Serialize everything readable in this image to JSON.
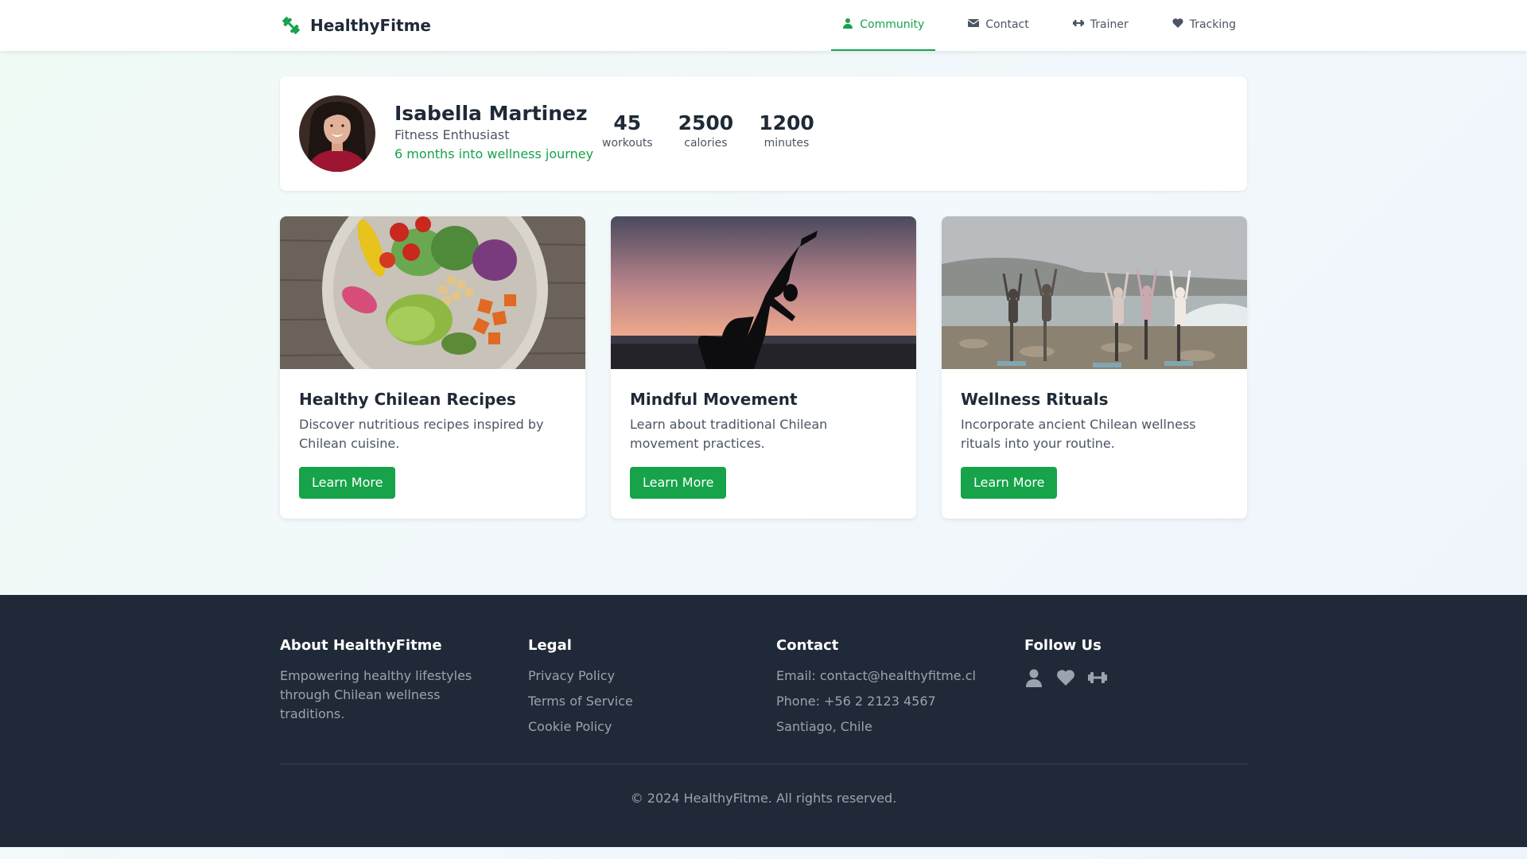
{
  "brand": {
    "name": "HealthyFitme",
    "icon": "dumbbell-icon",
    "accent": "#16a34a"
  },
  "nav": {
    "items": [
      {
        "label": "Community",
        "icon": "user-icon",
        "active": true
      },
      {
        "label": "Contact",
        "icon": "envelope-icon",
        "active": false
      },
      {
        "label": "Trainer",
        "icon": "dumbbell-icon",
        "active": false
      },
      {
        "label": "Tracking",
        "icon": "heart-icon",
        "active": false
      }
    ]
  },
  "profile": {
    "name": "Isabella Martinez",
    "role": "Fitness Enthusiast",
    "journey": "6 months into wellness journey",
    "stats": [
      {
        "value": "45",
        "label": "workouts"
      },
      {
        "value": "2500",
        "label": "calories"
      },
      {
        "value": "1200",
        "label": "minutes"
      }
    ]
  },
  "cards": [
    {
      "title": "Healthy Chilean Recipes",
      "desc": "Discover nutritious recipes inspired by Chilean cuisine.",
      "button": "Learn More"
    },
    {
      "title": "Mindful Movement",
      "desc": "Learn about traditional Chilean movement practices.",
      "button": "Learn More"
    },
    {
      "title": "Wellness Rituals",
      "desc": "Incorporate ancient Chilean wellness rituals into your routine.",
      "button": "Learn More"
    }
  ],
  "footer": {
    "about": {
      "title": "About HealthyFitme",
      "text": "Empowering healthy lifestyles through Chilean wellness traditions."
    },
    "legal": {
      "title": "Legal",
      "links": [
        "Privacy Policy",
        "Terms of Service",
        "Cookie Policy"
      ]
    },
    "contact": {
      "title": "Contact",
      "lines": [
        "Email: contact@healthyfitme.cl",
        "Phone: +56 2 2123 4567",
        "Santiago, Chile"
      ]
    },
    "follow": {
      "title": "Follow Us",
      "icons": [
        "user-icon",
        "heart-icon",
        "dumbbell-icon"
      ]
    },
    "copyright": "© 2024 HealthyFitme. All rights reserved."
  },
  "colors": {
    "footer_bg": "#1f2937",
    "button_bg": "#16a34a",
    "text_dark": "#1f2937",
    "text_muted": "#9ca3af"
  }
}
